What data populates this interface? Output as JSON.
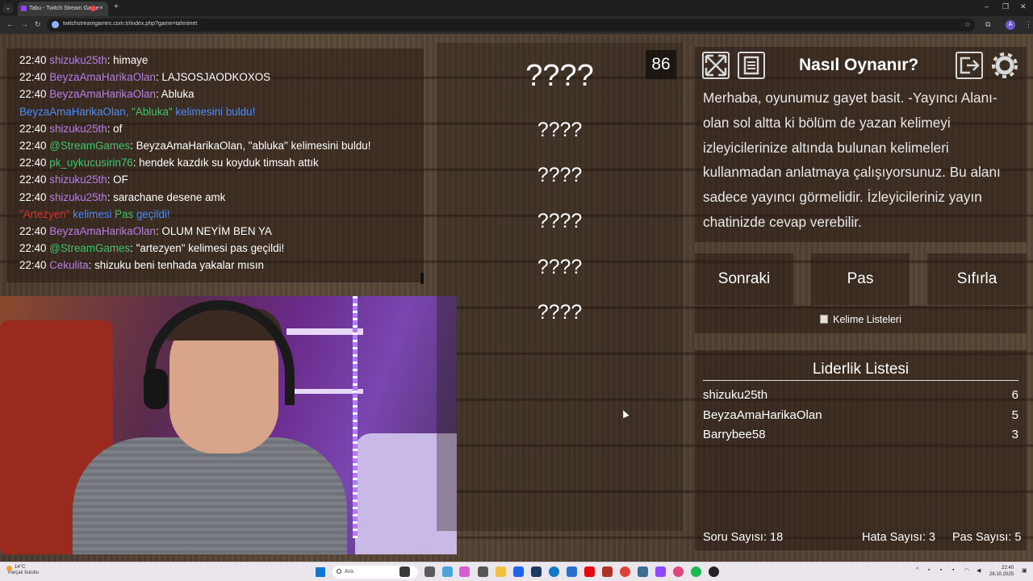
{
  "browser": {
    "tab_title": "Tabu - Twitch Stream Game",
    "url": "twitchstreamgames.com.tr/index.php?game=tahminet",
    "new_tab": "+",
    "tab_close": "×",
    "profile_initial": "A"
  },
  "chat": {
    "lines": [
      {
        "time": "22:40",
        "user": "shizuku25th",
        "user_color": "purple",
        "msg": ": himaye"
      },
      {
        "time": "22:40",
        "user": "BeyzaAmaHarikaOlan",
        "user_color": "purple",
        "msg": ": LAJSOSJAODKOXOS"
      },
      {
        "time": "22:40",
        "user": "BeyzaAmaHarikaOlan",
        "user_color": "purple",
        "msg": ": Abluka"
      },
      {
        "time": "",
        "user": "BeyzaAmaHarikaOlan, ",
        "user_color": "blue",
        "msg_parts": [
          {
            "text": "\"Abluka\"",
            "color": "green"
          },
          {
            "text": " kelimesini buldu!",
            "color": "blue"
          }
        ]
      },
      {
        "time": "22:40",
        "user": "shizuku25th",
        "user_color": "purple",
        "msg": ": of"
      },
      {
        "time": "22:40",
        "user": "@StreamGames",
        "user_color": "green",
        "msg": ": BeyzaAmaHarikaOlan, \"abluka\" kelimesini buldu!"
      },
      {
        "time": "22:40",
        "user": "pk_uykucusirin76",
        "user_color": "green",
        "msg": ": hendek kazdık su koyduk timsah attık"
      },
      {
        "time": "22:40",
        "user": "shizuku25th",
        "user_color": "purple",
        "msg": ": OF"
      },
      {
        "time": "22:40",
        "user": "shizuku25th",
        "user_color": "purple",
        "msg": ": sarachane desene amk"
      },
      {
        "time": "",
        "user": "\"Artezyen\"",
        "user_color": "red",
        "msg_parts": [
          {
            "text": " kelimesi ",
            "color": "blue"
          },
          {
            "text": "Pas",
            "color": "green"
          },
          {
            "text": " geçildi!",
            "color": "blue"
          }
        ]
      },
      {
        "time": "22:40",
        "user": "BeyzaAmaHarikaOlan",
        "user_color": "purple",
        "msg": ": OLUM NEYİM BEN YA"
      },
      {
        "time": "22:40",
        "user": "@StreamGames",
        "user_color": "green",
        "msg": ": \"artezyen\" kelimesi pas geçildi!"
      },
      {
        "time": "22:40",
        "user": "Cekulita",
        "user_color": "purple",
        "msg": ": shizuku beni tenhada yakalar mısın"
      }
    ]
  },
  "board": {
    "timer": "86",
    "main_word": "????",
    "forbidden_words": [
      "????",
      "????",
      "????",
      "????",
      "????"
    ]
  },
  "howto": {
    "title": "Nasıl Oynanır?",
    "text": "Merhaba, oyunumuz gayet basit. -Yayıncı Alanı- olan sol altta ki bölüm de yazan kelimeyi izleyicilerinize altında bulunan kelimeleri kullanmadan anlatmaya çalışıyorsunuz. Bu alanı sadece yayıncı görmelidir. İzleyicileriniz yayın chatinizde cevap verebilir."
  },
  "controls": {
    "next": "Sonraki",
    "pass": "Pas",
    "reset": "Sıfırla",
    "word_lists": "Kelime Listeleri"
  },
  "leaderboard": {
    "title": "Liderlik Listesi",
    "rows": [
      {
        "name": "shizuku25th",
        "score": "6"
      },
      {
        "name": "BeyzaAmaHarikaOlan",
        "score": "5"
      },
      {
        "name": "Barrybee58",
        "score": "3"
      }
    ]
  },
  "stats": {
    "questions": "Soru Sayısı: 18",
    "errors": "Hata Sayısı: 3",
    "passes": "Pas Sayısı: 5"
  },
  "taskbar": {
    "weather_temp": "14°C",
    "weather_desc": "Parçalı bulutlu",
    "search_placeholder": "Ara",
    "time": "22:40",
    "date": "28.10.2025"
  },
  "colors": {
    "purple": "#b87ee8",
    "green": "#3ec46d",
    "blue": "#4a8cff",
    "red": "#e03030"
  }
}
